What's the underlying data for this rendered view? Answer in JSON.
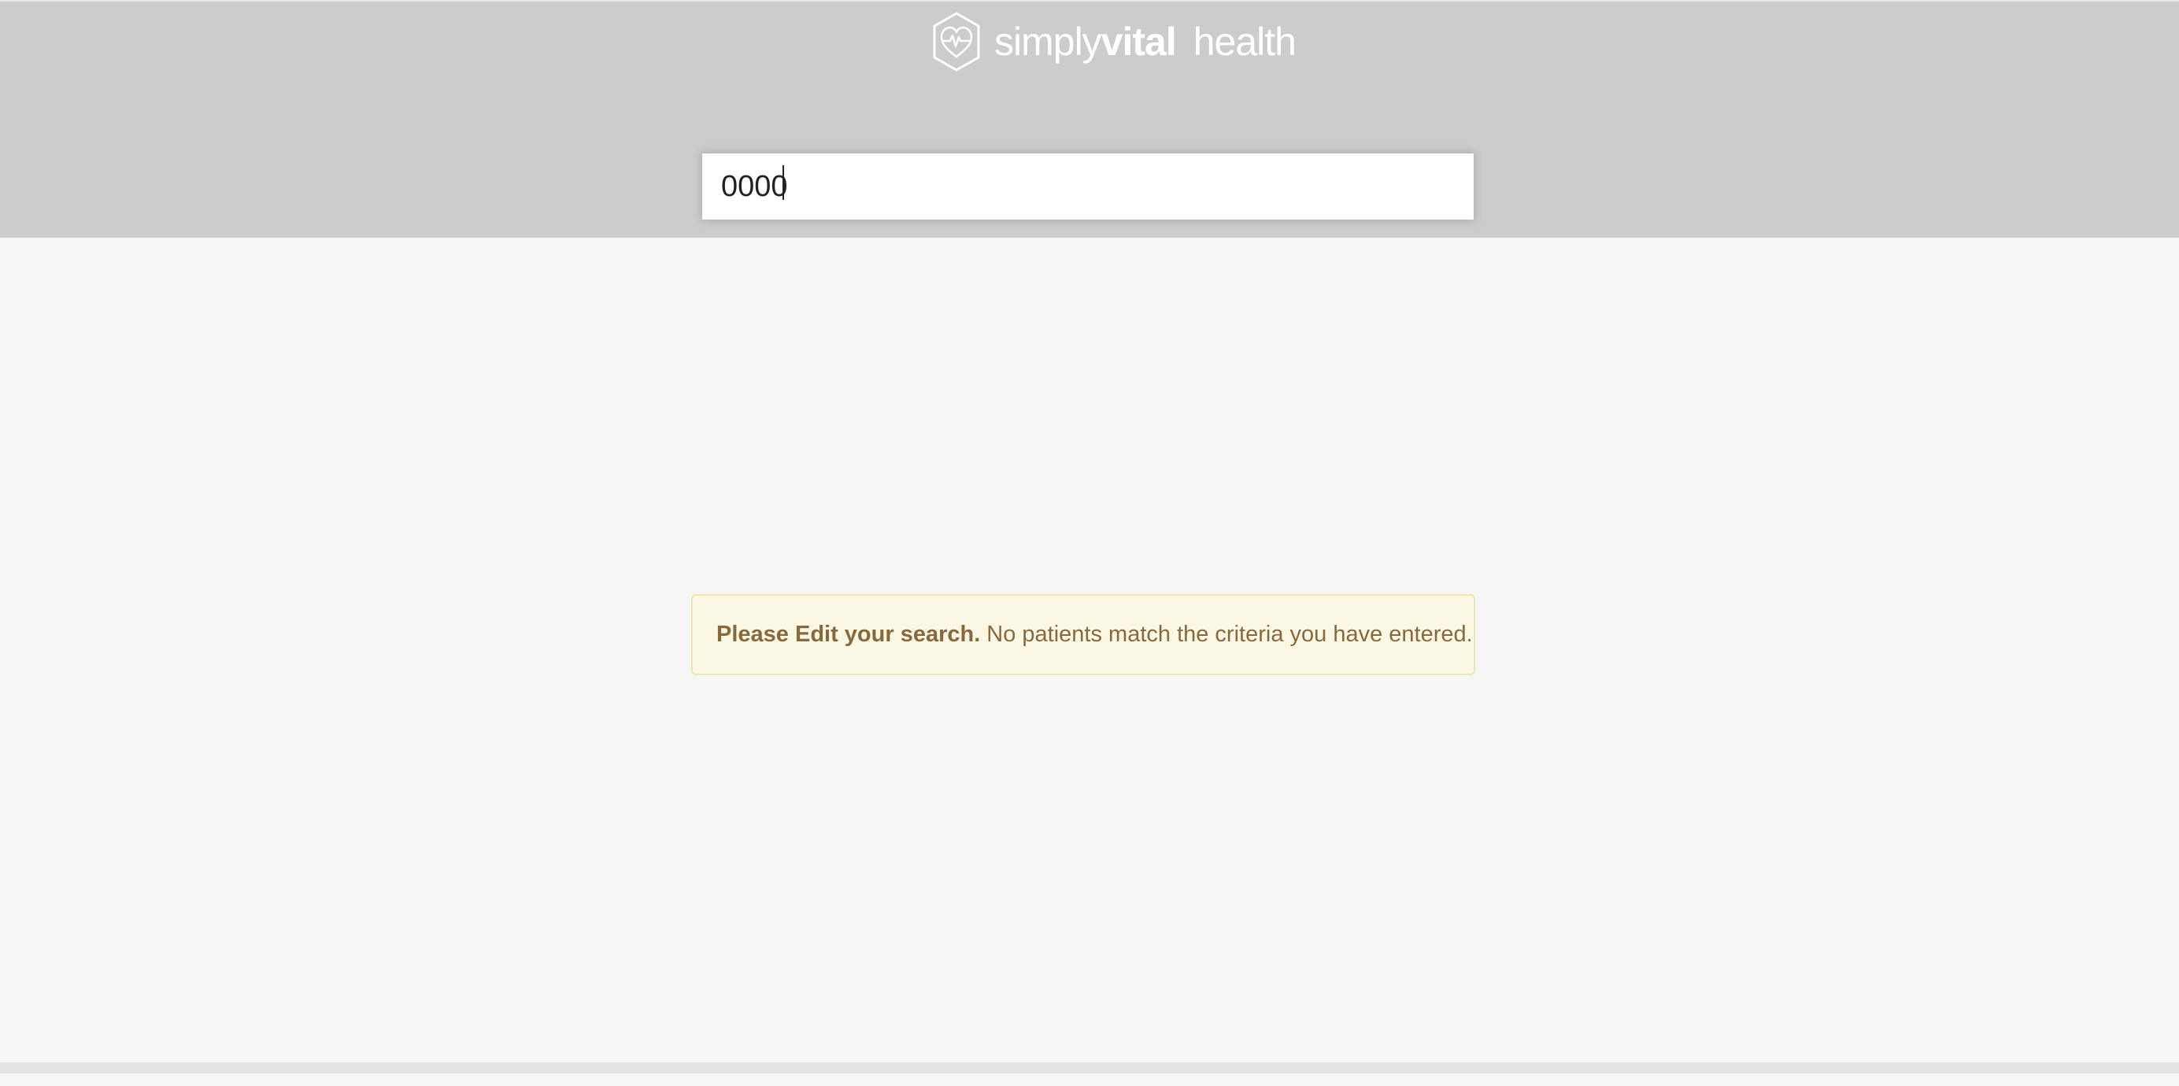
{
  "brand": {
    "name_light": "simply",
    "name_bold": "vital",
    "name_suffix": "health",
    "logo_icon": "hexagon-heartbeat-icon",
    "text_color": "#ffffff"
  },
  "search": {
    "value": "0000"
  },
  "alert": {
    "strong_text": "Please Edit your search.",
    "message": "No patients match the criteria you have entered.",
    "background": "#faf7e4",
    "text_color": "#87693d"
  },
  "colors": {
    "header_bg": "#cccccc",
    "page_bg": "#f6f6f6"
  }
}
